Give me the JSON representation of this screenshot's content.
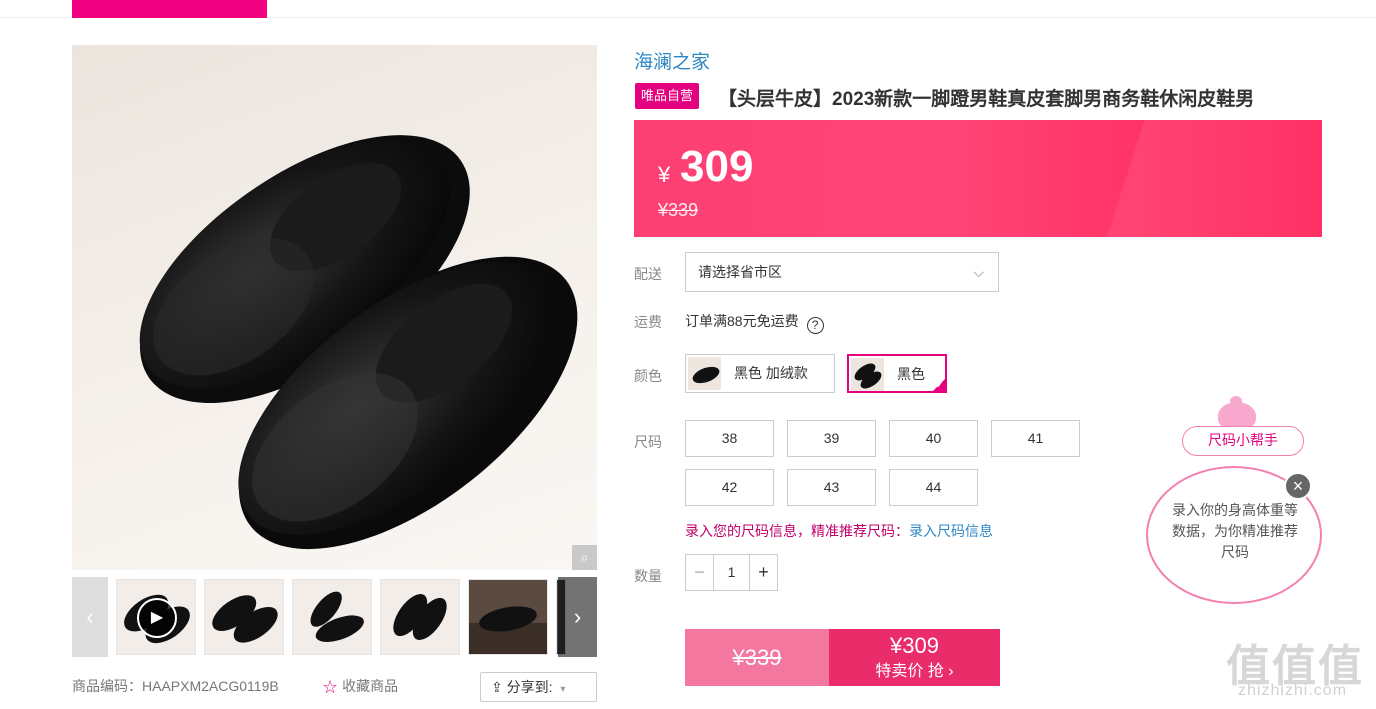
{
  "gallery": {
    "zoom_icon": "magnifier-icon",
    "thumbs_count": 6
  },
  "meta": {
    "code_label": "商品编码：HAAPXM2ACG0119B",
    "favorite_label": "收藏商品",
    "share_label": "分享到:"
  },
  "product": {
    "brand": "海澜之家",
    "badge": "唯品自营",
    "title": "【头层牛皮】2023新款一脚蹬男鞋真皮套脚男商务鞋休闲皮鞋男",
    "currency": "¥",
    "price": "309",
    "original_price": "¥339"
  },
  "delivery": {
    "label": "配送",
    "placeholder": "请选择省市区"
  },
  "shipping": {
    "label": "运费",
    "text": "订单满88元免运费"
  },
  "color": {
    "label": "颜色",
    "options": [
      {
        "name": "黑色 加绒款",
        "selected": false
      },
      {
        "name": "黑色",
        "selected": true
      }
    ]
  },
  "size": {
    "label": "尺码",
    "options": [
      "38",
      "39",
      "40",
      "41",
      "42",
      "43",
      "44"
    ],
    "hint": "录入您的尺码信息，精准推荐尺码：",
    "hint_link": "录入尺码信息"
  },
  "quantity": {
    "label": "数量",
    "value": "1",
    "minus": "−",
    "plus": "+"
  },
  "buy": {
    "original": "¥339",
    "price": "¥309",
    "action": "特卖价 抢 ›"
  },
  "helper": {
    "tag": "尺码小帮手",
    "text": "录入你的身高体重等数据，为你精准推荐尺码",
    "close": "×"
  },
  "watermark": {
    "logo": "值值值",
    "site": "zhizhizhi.com"
  },
  "colors": {
    "accent": "#e4007f",
    "price_bg": "#ff3f73",
    "link": "#2e88c6"
  }
}
